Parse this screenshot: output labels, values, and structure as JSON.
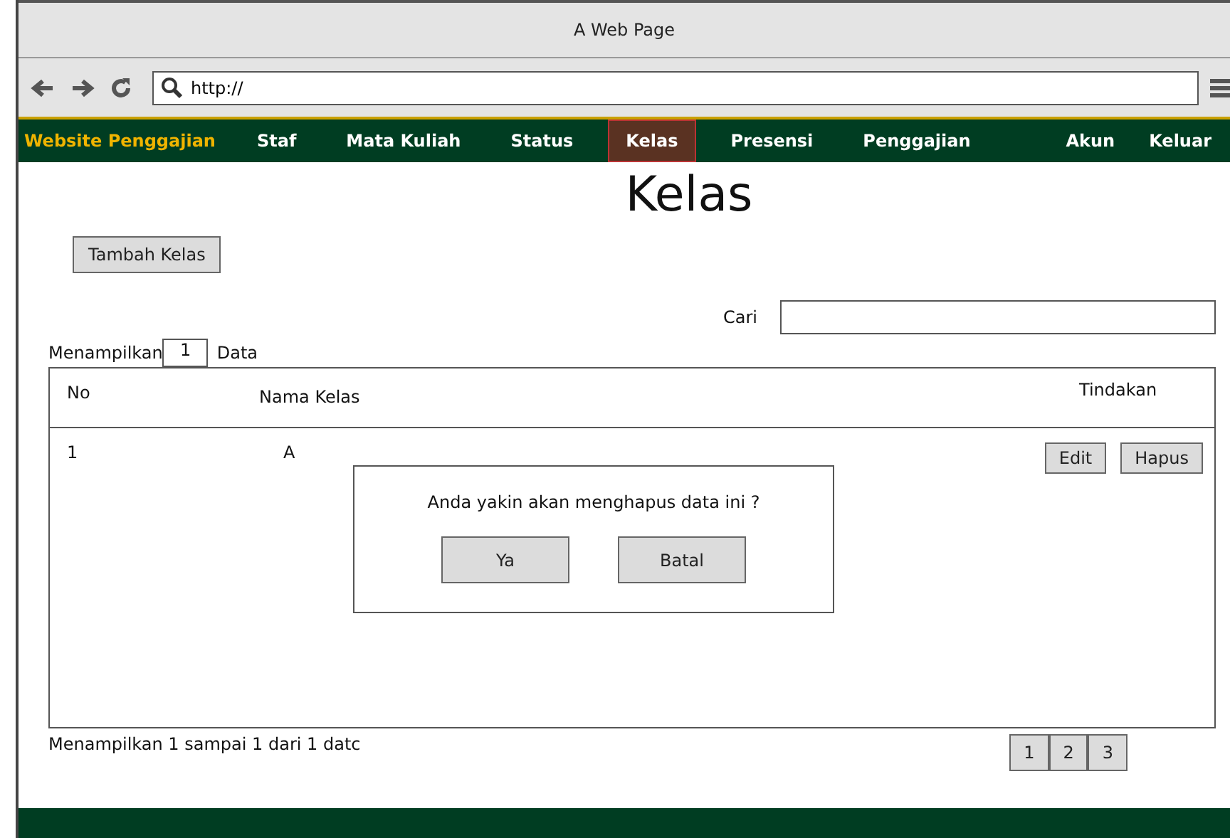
{
  "window": {
    "title": "A Web Page"
  },
  "address_bar": {
    "value": "http://"
  },
  "nav": {
    "brand": "Website Penggajian",
    "items": [
      {
        "label": "Staf",
        "selected": false
      },
      {
        "label": "Mata Kuliah",
        "selected": false
      },
      {
        "label": "Status",
        "selected": false
      },
      {
        "label": "Kelas",
        "selected": true
      },
      {
        "label": "Presensi",
        "selected": false
      },
      {
        "label": "Penggajian",
        "selected": false
      }
    ],
    "right_items": [
      "Akun",
      "Keluar"
    ]
  },
  "page_title": "Kelas",
  "add_button": "Tambah Kelas",
  "search": {
    "label": "Cari"
  },
  "page_size": {
    "label_before": "Menampilkan",
    "value": "1",
    "label_after": "Data"
  },
  "table": {
    "columns": [
      "No",
      "Nama Kelas",
      "Tindakan"
    ],
    "rows": [
      {
        "no": "1",
        "name": "A",
        "actions": [
          "Edit",
          "Hapus"
        ]
      }
    ]
  },
  "dialog": {
    "message": "Anda yakin akan menghapus data ini ?",
    "buttons": [
      "Ya",
      "Batal"
    ]
  },
  "summary": "Menampilkan 1 sampai 1 dari 1 datc",
  "pagination": [
    "1",
    "2",
    "3"
  ]
}
